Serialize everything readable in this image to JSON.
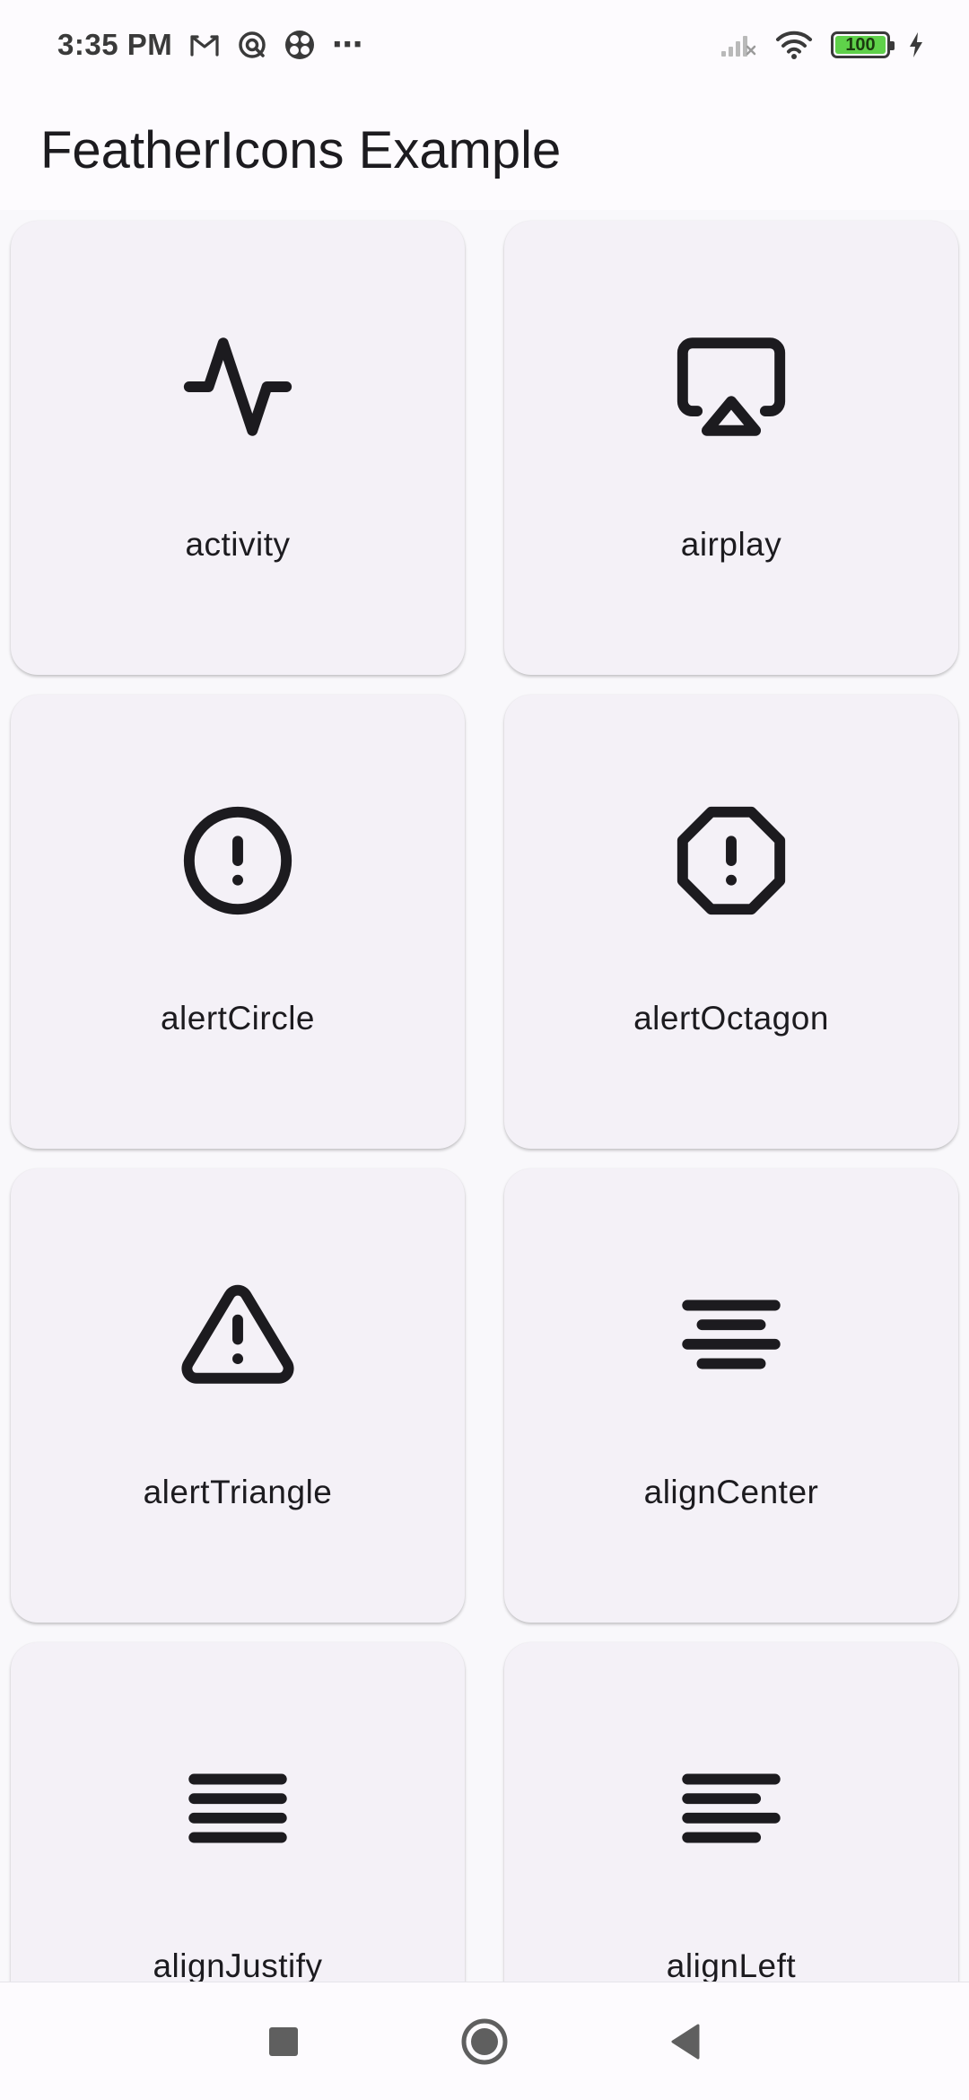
{
  "status_bar": {
    "time": "3:35 PM",
    "notification_icons": [
      "gmail-icon",
      "sync-icon",
      "pinwheel-icon"
    ],
    "overflow": "⋯",
    "battery_level": "100",
    "battery_fraction": 1.0,
    "charging": true
  },
  "app_bar": {
    "title": "FeatherIcons Example"
  },
  "icons": [
    {
      "label": "activity",
      "icon": "activity-icon"
    },
    {
      "label": "airplay",
      "icon": "airplay-icon"
    },
    {
      "label": "alertCircle",
      "icon": "alert-circle-icon"
    },
    {
      "label": "alertOctagon",
      "icon": "alert-octagon-icon"
    },
    {
      "label": "alertTriangle",
      "icon": "alert-triangle-icon"
    },
    {
      "label": "alignCenter",
      "icon": "align-center-icon"
    },
    {
      "label": "alignJustify",
      "icon": "align-justify-icon"
    },
    {
      "label": "alignLeft",
      "icon": "align-left-icon"
    }
  ],
  "nav_bar": {
    "buttons": [
      "recents-button",
      "home-button",
      "back-button"
    ]
  },
  "colors": {
    "card_background": "#f4f1f7",
    "page_background": "#f9f8fb",
    "icon_stroke": "#1c1b1f",
    "battery_fill": "#5fd14a"
  }
}
